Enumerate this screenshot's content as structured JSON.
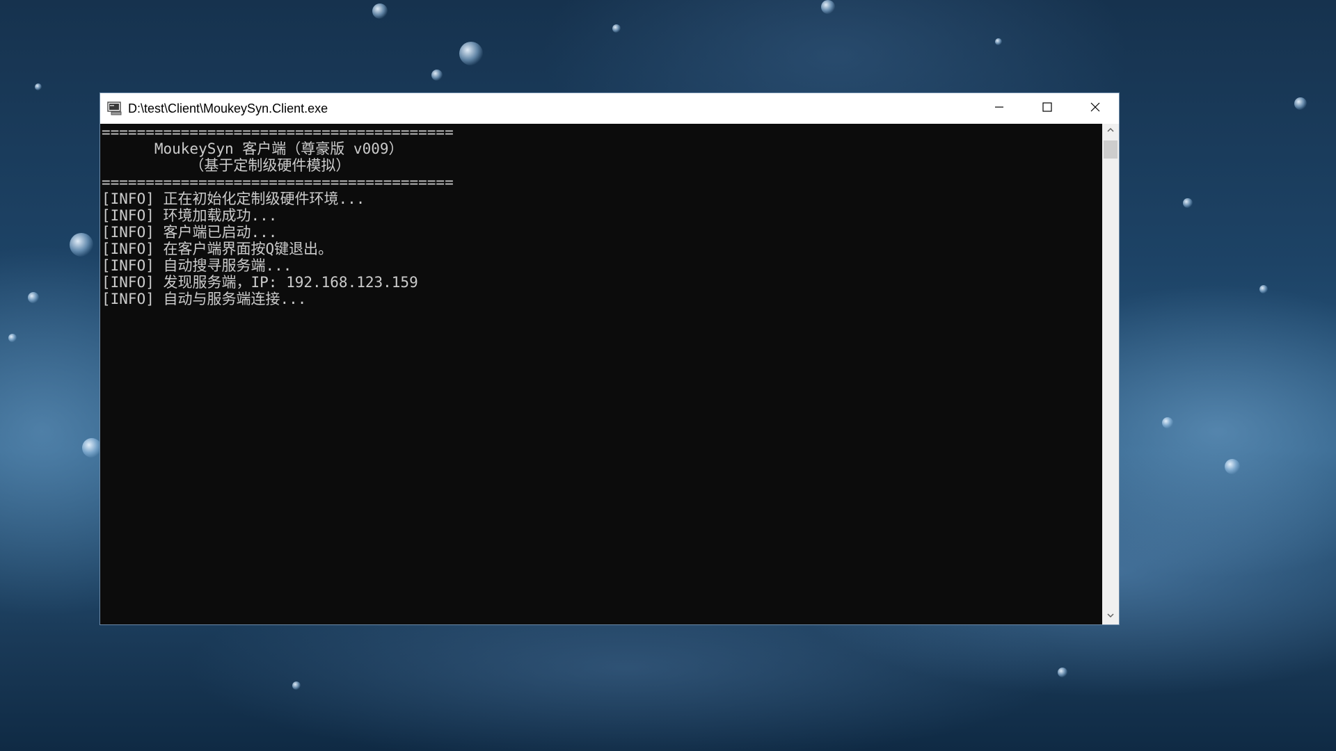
{
  "window": {
    "title": "D:\\test\\Client\\MoukeySyn.Client.exe",
    "icon": "console-app-icon",
    "controls": {
      "minimize": "minimize-icon",
      "maximize": "maximize-icon",
      "close": "close-icon"
    }
  },
  "console": {
    "lines": [
      "========================================",
      "      MoukeySyn 客户端（尊豪版 v009）",
      "          （基于定制级硬件模拟）",
      "========================================",
      "[INFO] 正在初始化定制级硬件环境...",
      "[INFO] 环境加载成功...",
      "[INFO] 客户端已启动...",
      "[INFO] 在客户端界面按Q键退出。",
      "[INFO] 自动搜寻服务端...",
      "[INFO] 发现服务端，IP: 192.168.123.159",
      "[INFO] 自动与服务端连接..."
    ]
  },
  "colors": {
    "console_bg": "#0c0c0c",
    "console_text": "#cccccc",
    "titlebar_bg": "#ffffff"
  }
}
